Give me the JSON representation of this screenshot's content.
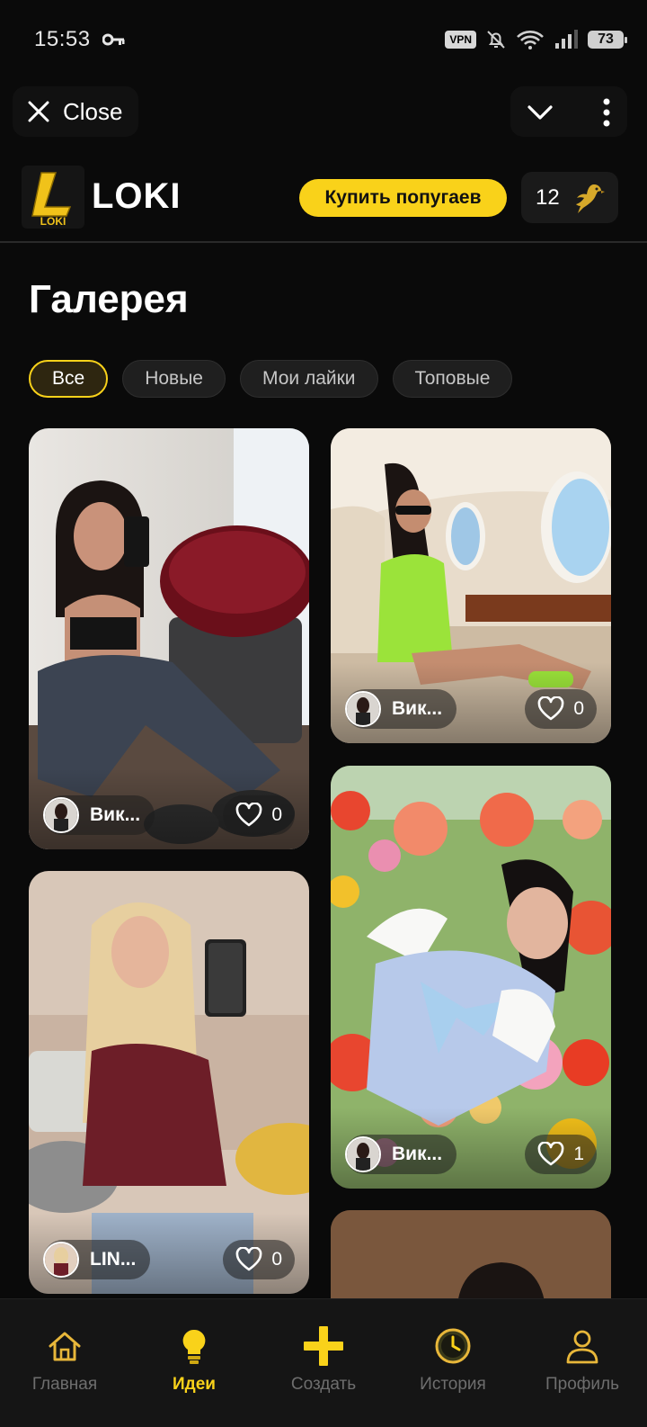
{
  "status_bar": {
    "time": "15:53",
    "vpn": "VPN",
    "battery": "73"
  },
  "top_bar": {
    "close_label": "Close"
  },
  "header": {
    "brand": "LOKI",
    "logo_text": "LOKI",
    "buy_button": "Купить попугаев",
    "balance": "12"
  },
  "gallery": {
    "title": "Галерея",
    "filters": [
      {
        "label": "Все",
        "active": true
      },
      {
        "label": "Новые",
        "active": false
      },
      {
        "label": "Мои лайки",
        "active": false
      },
      {
        "label": "Топовые",
        "active": false
      }
    ],
    "cards": [
      {
        "author": "Вик...",
        "likes": "0"
      },
      {
        "author": "Вик...",
        "likes": "0"
      },
      {
        "author": "LIN...",
        "likes": "0"
      },
      {
        "author": "Вик...",
        "likes": "1"
      }
    ]
  },
  "bottom_nav": [
    {
      "label": "Главная",
      "icon": "home-icon",
      "active": false
    },
    {
      "label": "Идеи",
      "icon": "lightbulb-icon",
      "active": true
    },
    {
      "label": "Создать",
      "icon": "plus-icon",
      "active": false
    },
    {
      "label": "История",
      "icon": "clock-icon",
      "active": false
    },
    {
      "label": "Профиль",
      "icon": "user-icon",
      "active": false
    }
  ],
  "colors": {
    "accent": "#f9d21a",
    "background": "#0a0a0a",
    "inactive_text": "#6e6e6e"
  }
}
